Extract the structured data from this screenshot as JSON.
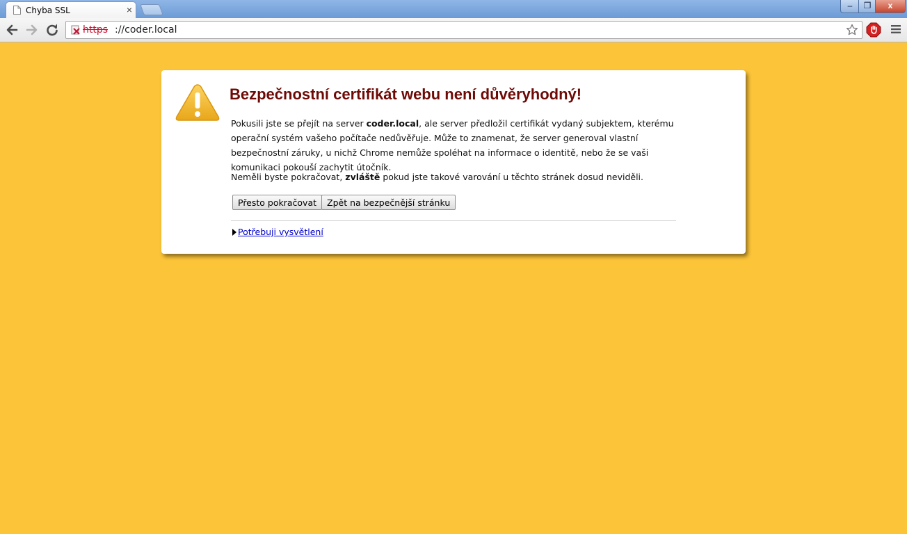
{
  "browser": {
    "tab_title": "Chyba SSL",
    "tab_close": "×",
    "url_scheme": "https",
    "url_rest": "://coder.local",
    "window_min": "–",
    "window_max": "❐",
    "window_close": "x"
  },
  "page": {
    "background": "#fcc438",
    "headline": "Bezpečnostní certifikát webu není důvěryhodný!",
    "headline_color": "#6e0a06",
    "p1_a": "Pokusili jste se přejít na server ",
    "p1_host": "coder.local",
    "p1_b": ", ale server předložil certifikát vydaný subjektem, kterému operační systém vašeho počítače nedůvěřuje. Může to znamenat, že server generoval vlastní bezpečnostní záruky, u nichž Chrome nemůže spoléhat na informace o identitě, nebo že se vaši komunikaci pokouší zachytit útočník.",
    "p2_a": "Neměli byste pokračovat, ",
    "p2_bold": "zvláště",
    "p2_b": " pokud jste takové varování u těchto stránek dosud neviděli.",
    "btn_proceed": "Přesto pokračovat",
    "btn_back": "Zpět na bezpečnější stránku",
    "more_link": "Potřebuji vysvětlení"
  }
}
